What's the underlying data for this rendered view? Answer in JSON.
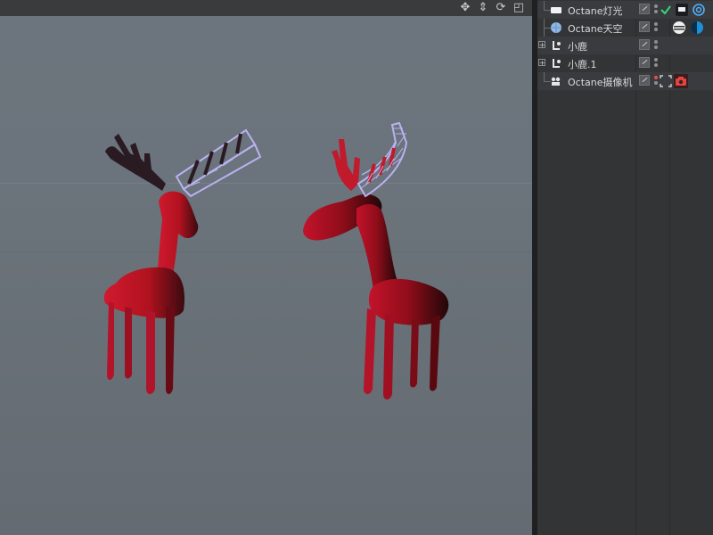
{
  "viewport": {
    "nav_icons": [
      "move-icon",
      "dolly-icon",
      "rotate-icon",
      "maximize-icon"
    ]
  },
  "object_manager": {
    "items": [
      {
        "name": "Octane灯光",
        "icon": "light-plane-icon",
        "expandable": false,
        "tags": [
          "check-tag-icon",
          "light-tag-icon",
          "target-tag-icon"
        ]
      },
      {
        "name": "Octane天空",
        "icon": "sky-sphere-icon",
        "expandable": false,
        "tags": [
          "environment-tag-icon",
          "hdri-tag-icon"
        ]
      },
      {
        "name": "小鹿",
        "icon": "figure-object-icon",
        "expandable": true,
        "tags": []
      },
      {
        "name": "小鹿.1",
        "icon": "figure-object-icon",
        "expandable": true,
        "tags": []
      },
      {
        "name": "Octane摄像机",
        "icon": "camera-object-icon",
        "expandable": false,
        "tags": [
          "focus-tag-icon",
          "camera-tag-icon"
        ]
      }
    ]
  },
  "colors": {
    "deer_red": "#c0152a",
    "selection_wire": "#b9b2f0",
    "panel_bg": "#333436",
    "viewport_bg": "#6b737c"
  }
}
